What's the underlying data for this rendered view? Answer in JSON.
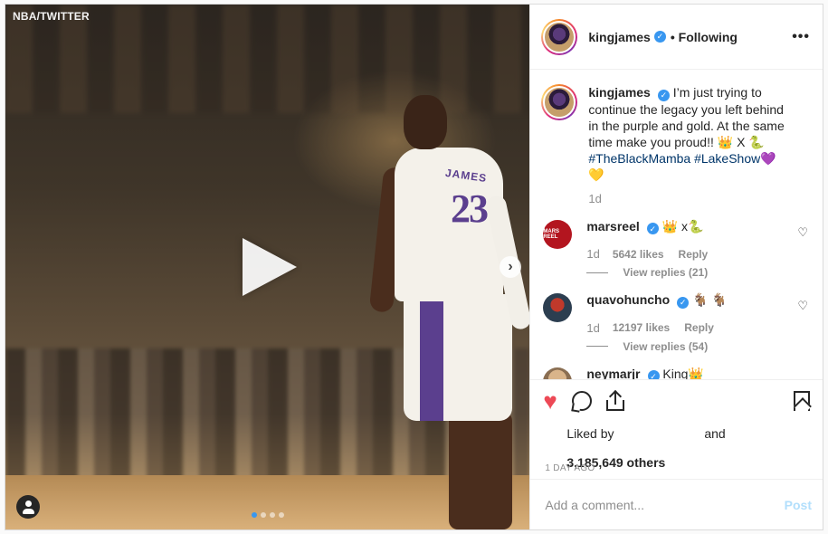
{
  "media": {
    "watermark": "NBA/TWITTER",
    "jersey_name": "JAMES",
    "jersey_number": "23",
    "carousel": {
      "count": 4,
      "active_index": 0
    }
  },
  "header": {
    "username": "kingjames",
    "separator": "•",
    "follow_status": "Following",
    "more_label": "•••"
  },
  "caption": {
    "username": "kingjames",
    "text": "I’m just trying to continue the legacy you left behind in the purple and gold. At the same time make you proud!! 👑  X 🐍",
    "hashtag1": "#TheBlackMamba",
    "hashtag2": "#LakeShow",
    "emoji_end": "💜  💛",
    "time": "1d"
  },
  "comments": [
    {
      "username": "marsreel",
      "text": "👑 x🐍",
      "avatar_text": "MARS REEL",
      "time": "1d",
      "likes": "5642 likes",
      "reply": "Reply",
      "replies": "View replies (21)"
    },
    {
      "username": "quavohuncho",
      "text": "🐐  🐐",
      "time": "1d",
      "likes": "12197 likes",
      "reply": "Reply",
      "replies": "View replies (54)"
    },
    {
      "username": "neymarjr",
      "text": "King👑"
    }
  ],
  "actions": {
    "liked_by_prefix": "Liked by",
    "and": "and",
    "others": "3,185,649 others",
    "timestamp": "1 DAY AGO"
  },
  "add_comment": {
    "placeholder": "Add a comment...",
    "post_label": "Post"
  },
  "colors": {
    "accent": "#3897f0",
    "like_red": "#ed4956",
    "post_disabled": "#b2dffc",
    "lakers_purple": "#5b3f8e"
  }
}
